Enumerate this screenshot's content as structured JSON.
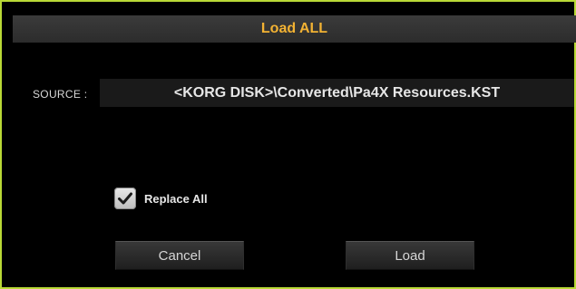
{
  "dialog": {
    "title": "Load ALL",
    "accent_color": "#f2b233",
    "border_color": "#b9d936"
  },
  "source": {
    "label": "SOURCE :",
    "value": "<KORG DISK>\\Converted\\Pa4X Resources.KST"
  },
  "options": {
    "replace_all": {
      "label": "Replace All",
      "checked": true,
      "icon": "checkmark-icon"
    }
  },
  "buttons": {
    "cancel_label": "Cancel",
    "load_label": "Load"
  }
}
